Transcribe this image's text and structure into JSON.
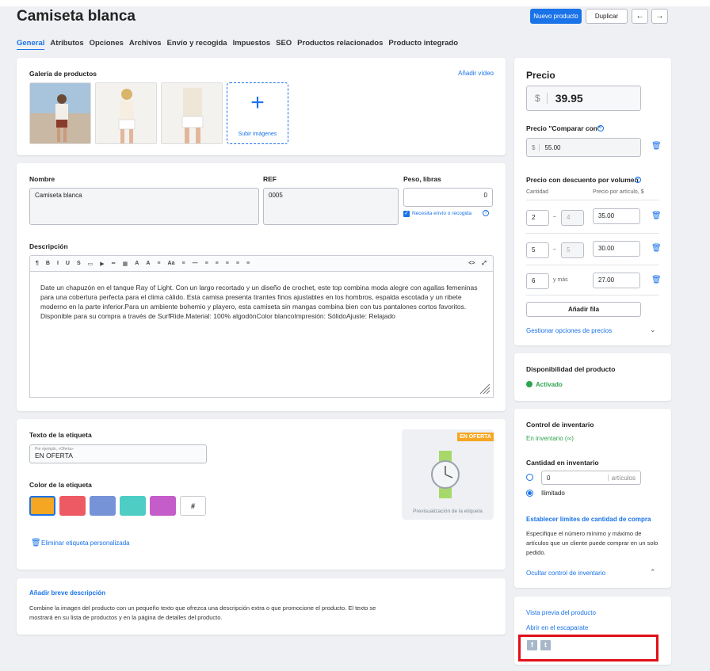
{
  "header": {
    "title": "Camiseta blanca",
    "new_product": "Nuevo producto",
    "duplicate": "Duplicar",
    "prev": "←",
    "next": "→"
  },
  "tabs": [
    "General",
    "Atributos",
    "Opciones",
    "Archivos",
    "Envío y recogida",
    "Impuestos",
    "SEO",
    "Productos relacionados",
    "Producto integrado"
  ],
  "gallery": {
    "title": "Galería de productos",
    "add_video": "Añadir vídeo",
    "upload": "Subir imágenes",
    "plus": "+"
  },
  "fields": {
    "name_label": "Nombre",
    "name_value": "Camiseta blanca",
    "ref_label": "REF",
    "ref_value": "0005",
    "weight_label": "Peso, libras",
    "weight_value": "0",
    "shipping_check": "Necesita envío o recogida",
    "description_label": "Descripción",
    "description": "Date un chapuzón en el tanque Ray of Light. Con un largo recortado y un diseño de crochet, este top combina moda alegre con agallas femeninas para una cobertura perfecta para el clima cálido. Esta camisa presenta tirantes finos ajustables en los hombros, espalda escotada y un ribete moderno en la parte inferior.Para un ambiente bohemio y playero, esta camiseta sin mangas combina bien con tus pantalones cortos favoritos. Disponible para su compra a través de SurfRide.Material: 100% algodónColor blancoImpresión: SólidoAjuste: Relajado"
  },
  "toolbar_items": [
    "¶",
    "B",
    "I",
    "U",
    "S",
    "▭",
    "▶",
    "∞",
    "▦",
    "A",
    "A",
    "≡",
    "Aa",
    "≡",
    "—",
    "≡",
    "≡",
    "≡",
    "≡",
    "≡"
  ],
  "toolbar_right": [
    "<>",
    "⤢"
  ],
  "badge": {
    "text_label": "Texto de la etiqueta",
    "placeholder": "Por ejemplo, «Oferta»",
    "value": "EN OFERTA",
    "color_label": "Color de la etiqueta",
    "hash": "#",
    "remove": "Eliminar etiqueta personalizada",
    "preview_badge": "EN OFERTA",
    "preview_caption": "Previsualización de la etiqueta",
    "colors": [
      "#f5a623",
      "#ee5a63",
      "#7793d8",
      "#4ecdc4",
      "#c45dc9"
    ]
  },
  "short_desc": {
    "link": "Añadir breve descripción",
    "text": "Combine la imagen del producto con un pequeño texto que ofrezca una descripción extra o que promocione el producto. El texto se mostrará en su lista de productos y en la página de detalles del producto."
  },
  "price": {
    "title": "Precio",
    "currency": "$",
    "value": "39.95",
    "compare_label": "Precio \"Comparar con\"",
    "compare_value": "55.00",
    "bulk_label": "Precio con descuento por volumen",
    "col_qty": "Cantidad",
    "col_price": "Precio por artículo, $",
    "tiers": [
      {
        "from": "2",
        "to": "4",
        "price": "35.00"
      },
      {
        "from": "5",
        "to": "5",
        "price": "30.00"
      },
      {
        "from": "6",
        "to": "y más",
        "price": "27.00"
      }
    ],
    "dash": "–",
    "add_row": "Añadir fila",
    "manage": "Gestionar opciones de precios"
  },
  "availability": {
    "title": "Disponibilidad del producto",
    "status": "Activado"
  },
  "inventory": {
    "title": "Control de inventario",
    "status": "En inventario (∞)",
    "qty_label": "Cantidad en inventario",
    "qty_value": "0",
    "qty_unit": "artículos",
    "unlimited": "Ilimitado",
    "limits_link": "Establecer límites de cantidad de compra",
    "limits_text": "Especifique el número mínimo y máximo de artículos que un cliente puede comprar en un solo pedido.",
    "hide": "Ocultar control de inventario"
  },
  "links": {
    "preview": "Vista previa del producto",
    "storefront": "Abrir en el escaparate",
    "facebook": "f",
    "twitter": "t"
  },
  "colors": {
    "accent": "#1a73e8",
    "active_green": "#2ea44f",
    "highlight": "#e0101a"
  }
}
